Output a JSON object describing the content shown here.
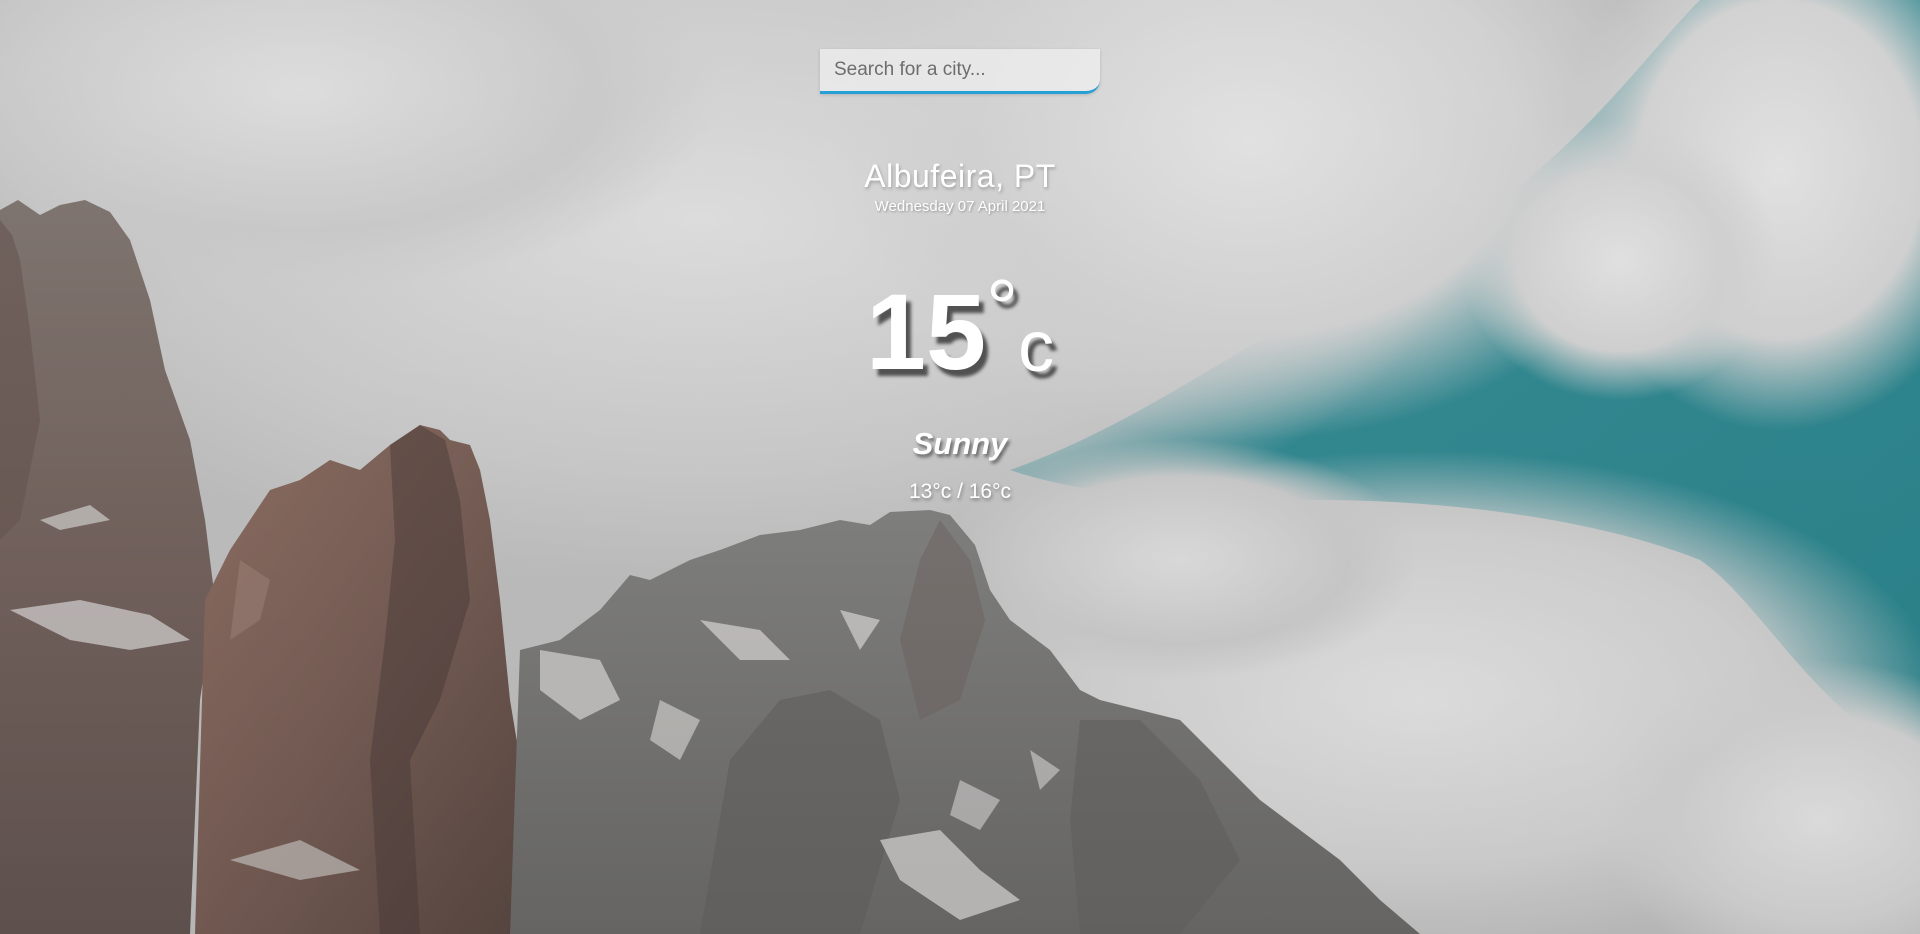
{
  "search": {
    "placeholder": "Search for a city..."
  },
  "location": {
    "city": "Albufeira, PT",
    "date": "Wednesday 07 April 2021"
  },
  "weather": {
    "temperature": "15",
    "degree_symbol": "°",
    "unit": "c",
    "condition": "Sunny",
    "range": "13°c / 16°c"
  },
  "colors": {
    "search_accent": "#27a0d6",
    "sky_teal": "#3f9ea6",
    "text": "#ffffff"
  }
}
